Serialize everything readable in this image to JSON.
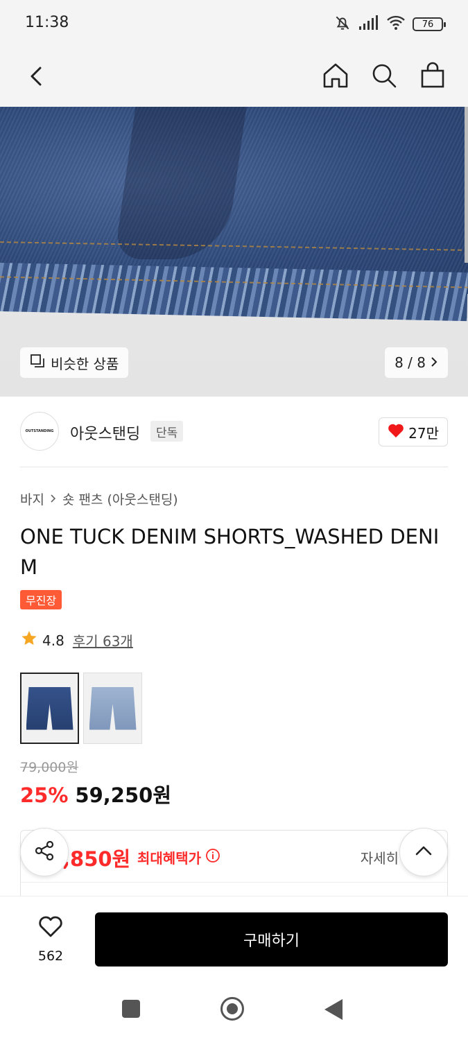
{
  "status_bar": {
    "time": "11:38",
    "battery": "76"
  },
  "hero": {
    "similar_label": "비슷한 상품",
    "pager": "8 / 8"
  },
  "brand": {
    "logo_text": "OUTSTANDING",
    "name": "아웃스탠딩",
    "tag": "단독",
    "likes": "27만"
  },
  "breadcrumb": {
    "category": "바지",
    "sub": "숏 팬츠 (아웃스탠딩)"
  },
  "product": {
    "title": "ONE TUCK DENIM SHORTS_WASHED DENIM",
    "badge": "무진장",
    "rating": "4.8",
    "reviews": "후기 63개",
    "thumbnails": [
      {
        "color": "#2f4c80"
      },
      {
        "color": "#8ea6c6"
      }
    ],
    "original_price": "79,000원",
    "discount": "25%",
    "price": "59,250원"
  },
  "benefit": {
    "price": ",850원",
    "label": "최대혜택가",
    "detail": "자세히"
  },
  "bottom": {
    "wish_count": "562",
    "buy_label": "구매하기"
  },
  "colors": {
    "accent_red": "#ff2a2a",
    "badge_orange": "#ff5a36"
  }
}
